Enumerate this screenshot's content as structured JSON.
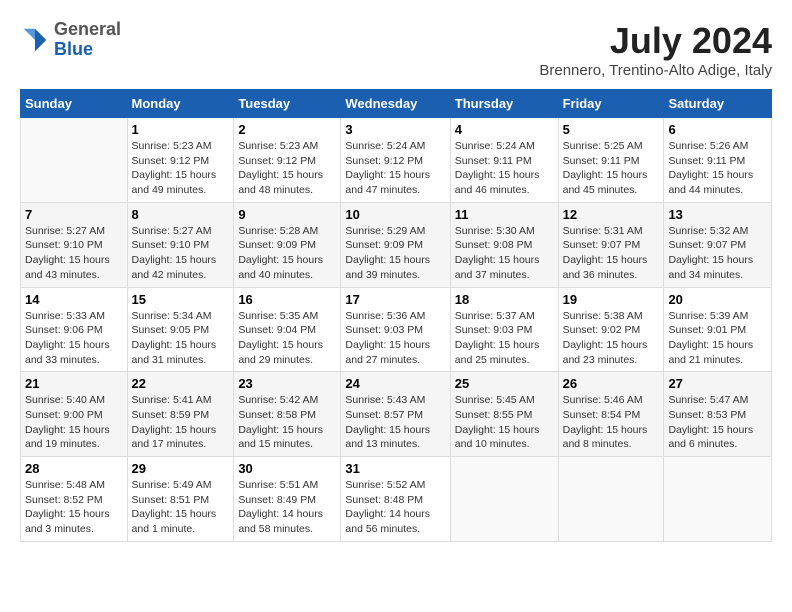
{
  "header": {
    "logo": {
      "general": "General",
      "blue": "Blue"
    },
    "title": "July 2024",
    "location": "Brennero, Trentino-Alto Adige, Italy"
  },
  "columns": [
    "Sunday",
    "Monday",
    "Tuesday",
    "Wednesday",
    "Thursday",
    "Friday",
    "Saturday"
  ],
  "weeks": [
    [
      {
        "day": "",
        "info": ""
      },
      {
        "day": "1",
        "info": "Sunrise: 5:23 AM\nSunset: 9:12 PM\nDaylight: 15 hours\nand 49 minutes."
      },
      {
        "day": "2",
        "info": "Sunrise: 5:23 AM\nSunset: 9:12 PM\nDaylight: 15 hours\nand 48 minutes."
      },
      {
        "day": "3",
        "info": "Sunrise: 5:24 AM\nSunset: 9:12 PM\nDaylight: 15 hours\nand 47 minutes."
      },
      {
        "day": "4",
        "info": "Sunrise: 5:24 AM\nSunset: 9:11 PM\nDaylight: 15 hours\nand 46 minutes."
      },
      {
        "day": "5",
        "info": "Sunrise: 5:25 AM\nSunset: 9:11 PM\nDaylight: 15 hours\nand 45 minutes."
      },
      {
        "day": "6",
        "info": "Sunrise: 5:26 AM\nSunset: 9:11 PM\nDaylight: 15 hours\nand 44 minutes."
      }
    ],
    [
      {
        "day": "7",
        "info": "Sunrise: 5:27 AM\nSunset: 9:10 PM\nDaylight: 15 hours\nand 43 minutes."
      },
      {
        "day": "8",
        "info": "Sunrise: 5:27 AM\nSunset: 9:10 PM\nDaylight: 15 hours\nand 42 minutes."
      },
      {
        "day": "9",
        "info": "Sunrise: 5:28 AM\nSunset: 9:09 PM\nDaylight: 15 hours\nand 40 minutes."
      },
      {
        "day": "10",
        "info": "Sunrise: 5:29 AM\nSunset: 9:09 PM\nDaylight: 15 hours\nand 39 minutes."
      },
      {
        "day": "11",
        "info": "Sunrise: 5:30 AM\nSunset: 9:08 PM\nDaylight: 15 hours\nand 37 minutes."
      },
      {
        "day": "12",
        "info": "Sunrise: 5:31 AM\nSunset: 9:07 PM\nDaylight: 15 hours\nand 36 minutes."
      },
      {
        "day": "13",
        "info": "Sunrise: 5:32 AM\nSunset: 9:07 PM\nDaylight: 15 hours\nand 34 minutes."
      }
    ],
    [
      {
        "day": "14",
        "info": "Sunrise: 5:33 AM\nSunset: 9:06 PM\nDaylight: 15 hours\nand 33 minutes."
      },
      {
        "day": "15",
        "info": "Sunrise: 5:34 AM\nSunset: 9:05 PM\nDaylight: 15 hours\nand 31 minutes."
      },
      {
        "day": "16",
        "info": "Sunrise: 5:35 AM\nSunset: 9:04 PM\nDaylight: 15 hours\nand 29 minutes."
      },
      {
        "day": "17",
        "info": "Sunrise: 5:36 AM\nSunset: 9:03 PM\nDaylight: 15 hours\nand 27 minutes."
      },
      {
        "day": "18",
        "info": "Sunrise: 5:37 AM\nSunset: 9:03 PM\nDaylight: 15 hours\nand 25 minutes."
      },
      {
        "day": "19",
        "info": "Sunrise: 5:38 AM\nSunset: 9:02 PM\nDaylight: 15 hours\nand 23 minutes."
      },
      {
        "day": "20",
        "info": "Sunrise: 5:39 AM\nSunset: 9:01 PM\nDaylight: 15 hours\nand 21 minutes."
      }
    ],
    [
      {
        "day": "21",
        "info": "Sunrise: 5:40 AM\nSunset: 9:00 PM\nDaylight: 15 hours\nand 19 minutes."
      },
      {
        "day": "22",
        "info": "Sunrise: 5:41 AM\nSunset: 8:59 PM\nDaylight: 15 hours\nand 17 minutes."
      },
      {
        "day": "23",
        "info": "Sunrise: 5:42 AM\nSunset: 8:58 PM\nDaylight: 15 hours\nand 15 minutes."
      },
      {
        "day": "24",
        "info": "Sunrise: 5:43 AM\nSunset: 8:57 PM\nDaylight: 15 hours\nand 13 minutes."
      },
      {
        "day": "25",
        "info": "Sunrise: 5:45 AM\nSunset: 8:55 PM\nDaylight: 15 hours\nand 10 minutes."
      },
      {
        "day": "26",
        "info": "Sunrise: 5:46 AM\nSunset: 8:54 PM\nDaylight: 15 hours\nand 8 minutes."
      },
      {
        "day": "27",
        "info": "Sunrise: 5:47 AM\nSunset: 8:53 PM\nDaylight: 15 hours\nand 6 minutes."
      }
    ],
    [
      {
        "day": "28",
        "info": "Sunrise: 5:48 AM\nSunset: 8:52 PM\nDaylight: 15 hours\nand 3 minutes."
      },
      {
        "day": "29",
        "info": "Sunrise: 5:49 AM\nSunset: 8:51 PM\nDaylight: 15 hours\nand 1 minute."
      },
      {
        "day": "30",
        "info": "Sunrise: 5:51 AM\nSunset: 8:49 PM\nDaylight: 14 hours\nand 58 minutes."
      },
      {
        "day": "31",
        "info": "Sunrise: 5:52 AM\nSunset: 8:48 PM\nDaylight: 14 hours\nand 56 minutes."
      },
      {
        "day": "",
        "info": ""
      },
      {
        "day": "",
        "info": ""
      },
      {
        "day": "",
        "info": ""
      }
    ]
  ]
}
